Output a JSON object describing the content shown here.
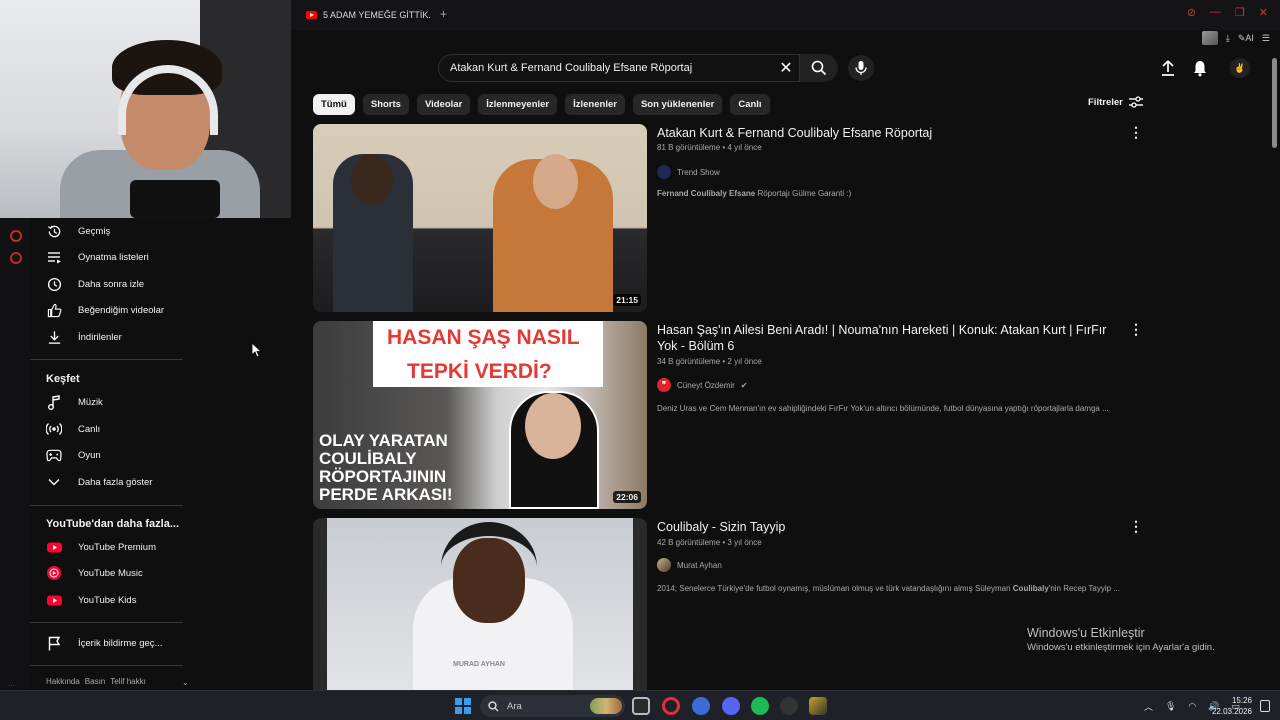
{
  "browser": {
    "tab_title": "5 ADAM YEMEĞE GİTTİK.",
    "new_tab_symbol": "+",
    "ext_ai_label": "AI",
    "accent": "#e0303a"
  },
  "search": {
    "query": "Atakan Kurt & Fernand Coulibaly Efsane Röportaj",
    "clear_symbol": "✕"
  },
  "chips": [
    "Tümü",
    "Shorts",
    "Videolar",
    "İzlenmeyenler",
    "İzlenenler",
    "Son yüklenenler",
    "Canlı"
  ],
  "filters_label": "Filtreler",
  "sidebar": {
    "you_items": [
      "Geçmiş",
      "Oynatma listeleri",
      "Daha sonra izle",
      "Beğendiğim videolar",
      "İndirilenler"
    ],
    "explore_heading": "Keşfet",
    "explore_items": [
      "Müzik",
      "Canlı",
      "Oyun",
      "Daha fazla göster"
    ],
    "more_heading": "YouTube'dan daha fazla...",
    "more_items": [
      "YouTube Premium",
      "YouTube Music",
      "YouTube Kids"
    ],
    "report_item": "İçerik bildirme geç...",
    "footer": [
      "Hakkında",
      "Basın",
      "Telif hakkı"
    ]
  },
  "results": [
    {
      "title": "Atakan Kurt & Fernand Coulibaly Efsane Röportaj",
      "meta": "81 B görüntüleme • 4 yıl önce",
      "channel": "Trend Show",
      "desc_bold": "Fernand Coulibaly Efsane",
      "desc_rest": " Röportajı Gülme Garanti :)",
      "duration": "21:15"
    },
    {
      "title": "Hasan Şaş'ın Ailesi Beni Aradı! | Nouma'nın Hareketi | Konuk: Atakan Kurt | FırFır Yok - Bölüm 6",
      "meta": "34 B görüntüleme • 2 yıl önce",
      "channel": "Cüneyt Özdemir",
      "desc": "Deniz Uras ve Cem Mennan'ın ev sahipliğindeki FırFır Yok'un altıncı bölümünde, futbol dünyasına yaptığı röportajlarla damga ...",
      "duration": "22:06",
      "thumb_text_top": [
        "HASAN ŞAŞ NASIL",
        "TEPKİ VERDİ?"
      ],
      "thumb_text_bottom": [
        "OLAY YARATAN",
        "COULİBALY",
        "RÖPORTAJININ",
        "PERDE ARKASI!"
      ]
    },
    {
      "title": "Coulibaly - Sizin Tayyip",
      "meta": "42 B görüntüleme • 3 yıl önce",
      "channel": "Murat Ayhan",
      "desc_pre": "2014; Senelerce Türkiye'de futbol oynamış, müslüman olmuş ve türk vatandaşlığını almış Süleyman ",
      "desc_bold": "Coulibaly",
      "desc_post": "'nin Recep Tayyip ...",
      "thumb_watermark": "MURAD AYHAN"
    }
  ],
  "activation": {
    "title": "Windows'u Etkinleştir",
    "subtitle": "Windows'u etkinleştirmek için Ayarlar'a gidin."
  },
  "taskbar": {
    "search_placeholder": "Ara",
    "time": "15:26",
    "date": "22.03.2026"
  }
}
